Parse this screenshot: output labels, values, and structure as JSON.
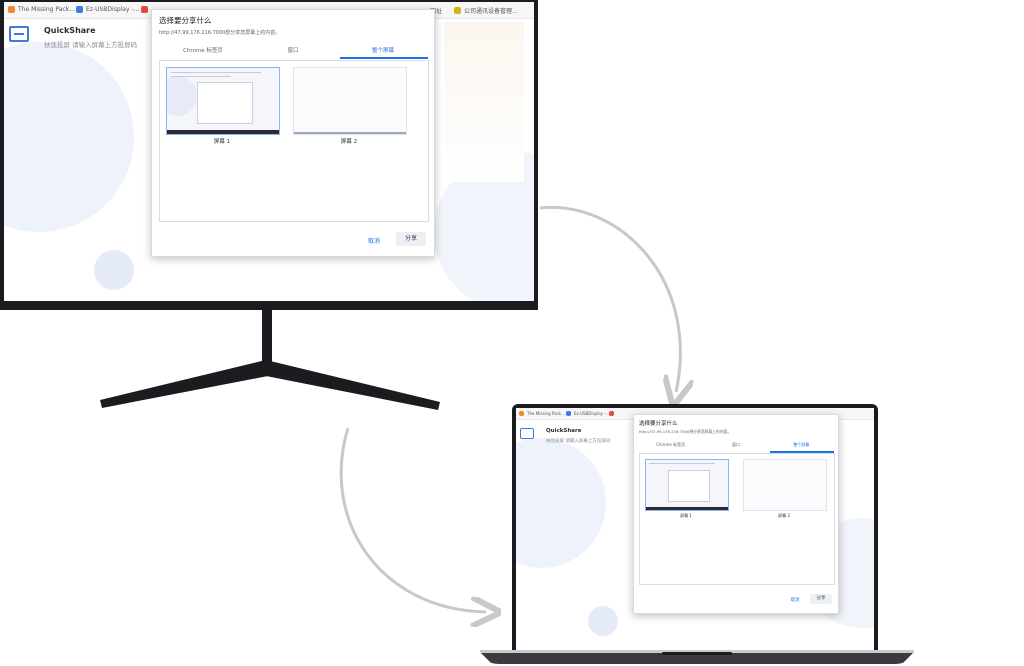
{
  "browser_tabs": [
    {
      "label": "The Missing Pack...",
      "icon": "orange-favicon"
    },
    {
      "label": "Ez-USBDisplay -...",
      "icon": "blue-doc-favicon"
    },
    {
      "label": "",
      "icon": "red-favicon"
    }
  ],
  "browser_tabs_right": [
    {
      "label": "网址",
      "icon": ""
    },
    {
      "label": "公司通讯设备管理...",
      "icon": "yellow-favicon"
    }
  ],
  "app": {
    "brand": "QuickShare",
    "subtitle": "扶恁投屏 请输入屏幕上方投屏码"
  },
  "dialog": {
    "title": "选择要分享什么",
    "subtitle": "http://47.99.176.216:7000想分享您屏幕上的内容。",
    "tabs": [
      "Chrome 标签页",
      "窗口",
      "整个屏幕"
    ],
    "active_tab": 2,
    "screens": [
      {
        "label": "屏幕 1"
      },
      {
        "label": "屏幕 2"
      }
    ],
    "cancel_label": "取消",
    "share_label": "分享"
  },
  "colors": {
    "accent": "#1a73e8",
    "device_frame": "#1c1c20",
    "arrow": "#c8c8c8"
  }
}
